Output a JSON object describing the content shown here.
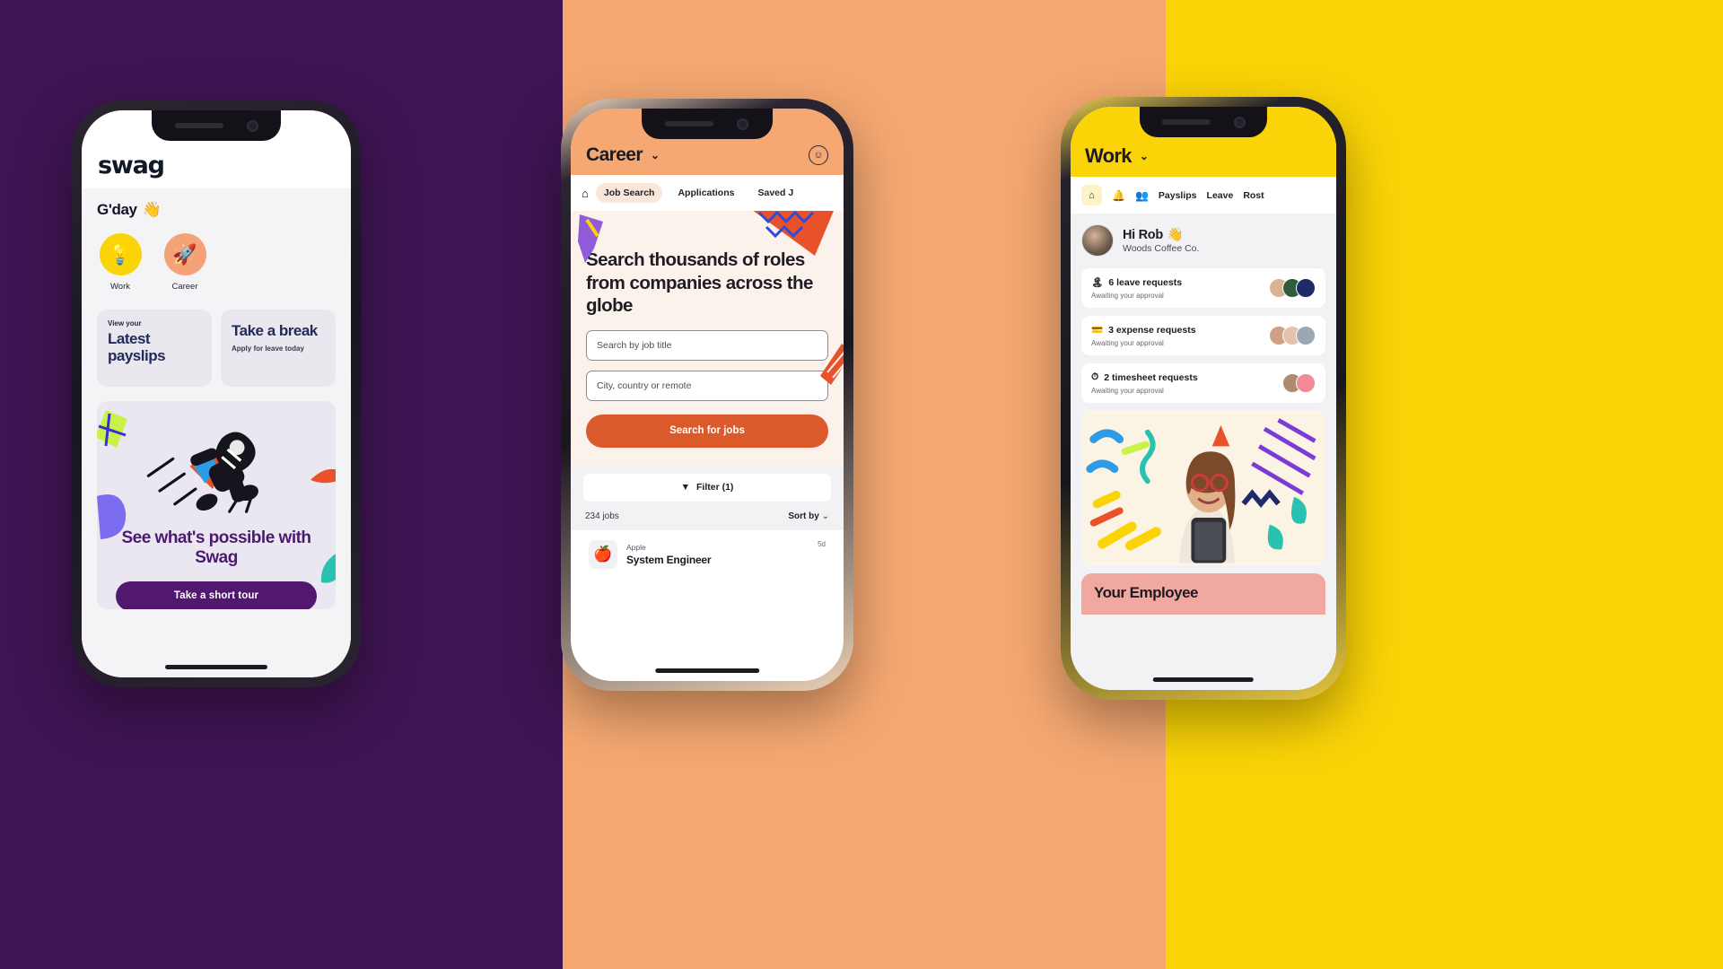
{
  "background": {
    "panel_purple": "#3E1452",
    "panel_peach": "#F5A871",
    "panel_yellow": "#FBD407"
  },
  "phone1": {
    "logo": "swag",
    "greeting": "G'day",
    "greeting_emoji": "👋",
    "shortcuts": [
      {
        "label": "Work",
        "icon": "lightbulb-icon",
        "glyph": "💡",
        "color": "#FBD407"
      },
      {
        "label": "Career",
        "icon": "rocket-icon",
        "glyph": "🚀",
        "color": "#F6A278"
      }
    ],
    "tiles": [
      {
        "kicker": "View your",
        "title": "Latest payslips",
        "sub": ""
      },
      {
        "kicker": "",
        "title": "Take a break",
        "sub": "Apply for leave today"
      }
    ],
    "promo": {
      "illustration": "astronaut-rocket-illustration",
      "title": "See what's possible with Swag",
      "button": "Take a short tour",
      "button_color": "#52176F"
    }
  },
  "phone2": {
    "header": {
      "title": "Career",
      "chevron": "chevron-down-icon",
      "account_icon": "account-circle-icon"
    },
    "tabs": [
      {
        "label": "",
        "icon": "home-icon",
        "active": false
      },
      {
        "label": "Job Search",
        "active": true
      },
      {
        "label": "Applications",
        "active": false
      },
      {
        "label": "Saved J",
        "active": false
      }
    ],
    "hero": {
      "heading": "Search thousands of roles from companies across the globe",
      "job_title_placeholder": "Search by job title",
      "job_title_value": "",
      "location_placeholder": "City, country or remote",
      "location_value": "",
      "search_button": "Search for jobs",
      "search_button_color": "#DB5A2C"
    },
    "filter": {
      "label": "Filter (1)",
      "icon": "filter-icon"
    },
    "results": {
      "count": "234 jobs",
      "sort_label": "Sort by",
      "sort_icon": "chevron-down-icon",
      "jobs": [
        {
          "company": "Apple",
          "logo": "apple-icon",
          "title": "System Engineer",
          "age": "5d"
        }
      ]
    }
  },
  "phone3": {
    "header": {
      "title": "Work",
      "chevron": "chevron-down-icon"
    },
    "tabs": [
      {
        "label": "",
        "icon": "home-icon"
      },
      {
        "label": "",
        "icon": "bell-icon"
      },
      {
        "label": "",
        "icon": "people-icon"
      },
      {
        "label": "Payslips"
      },
      {
        "label": "Leave"
      },
      {
        "label": "Rost"
      }
    ],
    "profile": {
      "greeting": "Hi Rob",
      "emoji": "👋",
      "organisation": "Woods Coffee Co.",
      "avatar": "user-avatar"
    },
    "requests": [
      {
        "icon": "leave-icon",
        "title": "6 leave requests",
        "sub": "Awaiting your approval",
        "avatars": [
          "#d8b394",
          "#2f5d3a",
          "#1f2a6b"
        ]
      },
      {
        "icon": "expense-icon",
        "title": "3 expense requests",
        "sub": "Awaiting your approval",
        "avatars": [
          "#cfa184",
          "#e3c3ae",
          "#9aa8b4"
        ]
      },
      {
        "icon": "timesheet-icon",
        "title": "2 timesheet requests",
        "sub": "Awaiting your approval",
        "avatars": [
          "#b08a6c",
          "#ef8a96"
        ]
      }
    ],
    "media_card": {
      "alt": "woman-with-phone-illustration"
    },
    "employee_card": {
      "title": "Your Employee"
    }
  }
}
